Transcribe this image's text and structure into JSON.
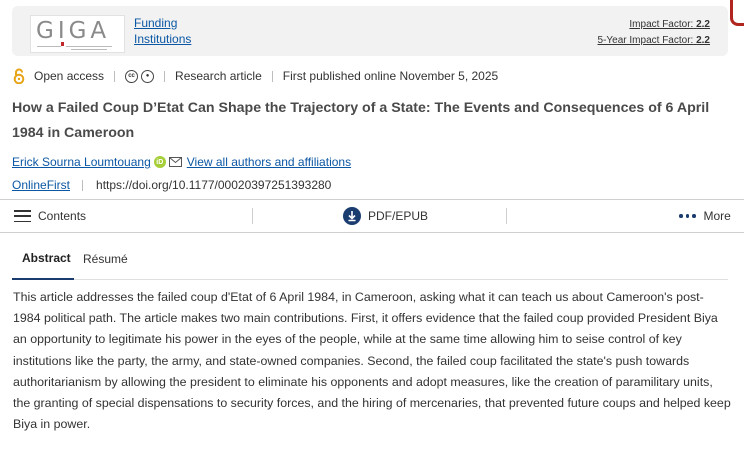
{
  "journal": {
    "logo_text": "GIGA",
    "links": [
      "Funding",
      "Institutions"
    ],
    "impact_factor_label": "Impact Factor:",
    "impact_factor_value": "2.2",
    "five_year_label": "5-Year Impact Factor:",
    "five_year_value": "2.2"
  },
  "meta": {
    "access": "Open access",
    "license_icons": [
      "cc",
      "by"
    ],
    "article_type": "Research article",
    "published": "First published online November 5, 2025"
  },
  "article": {
    "title": "How a Failed Coup D’Etat Can Shape the Trajectory of a State: The Events and Consequences of 6 April 1984 in Cameroon",
    "author": "Erick Sourna Loumtouang",
    "view_authors": "View all authors and affiliations",
    "online_first": "OnlineFirst",
    "doi": "https://doi.org/10.1177/00020397251393280"
  },
  "toolbar": {
    "contents": "Contents",
    "pdf": "PDF/EPUB",
    "more": "More"
  },
  "tabs": [
    {
      "label": "Abstract",
      "active": true
    },
    {
      "label": "Résumé",
      "active": false
    }
  ],
  "abstract_text": "This article addresses the failed coup d'Etat of 6 April 1984, in Cameroon, asking what it can teach us about Cameroon's post-1984 political path. The article makes two main contributions. First, it offers evidence that the failed coup provided President Biya an opportunity to legitimate his power in the eyes of the people, while at the same time allowing him to seise control of key institutions like the party, the army, and state-owned companies. Second, the failed coup facilitated the state's push towards authoritarianism by allowing the president to eliminate his opponents and adopt measures, like the creation of paramilitary units, the granting of special dispensations to security forces, and the hiring of mercenaries, that prevented future coups and helped keep Biya in power.",
  "colors": {
    "link": "#0b57a4",
    "accent": "#1a3c6e",
    "orcid": "#a6ce39",
    "open_access": "#e8a317"
  }
}
